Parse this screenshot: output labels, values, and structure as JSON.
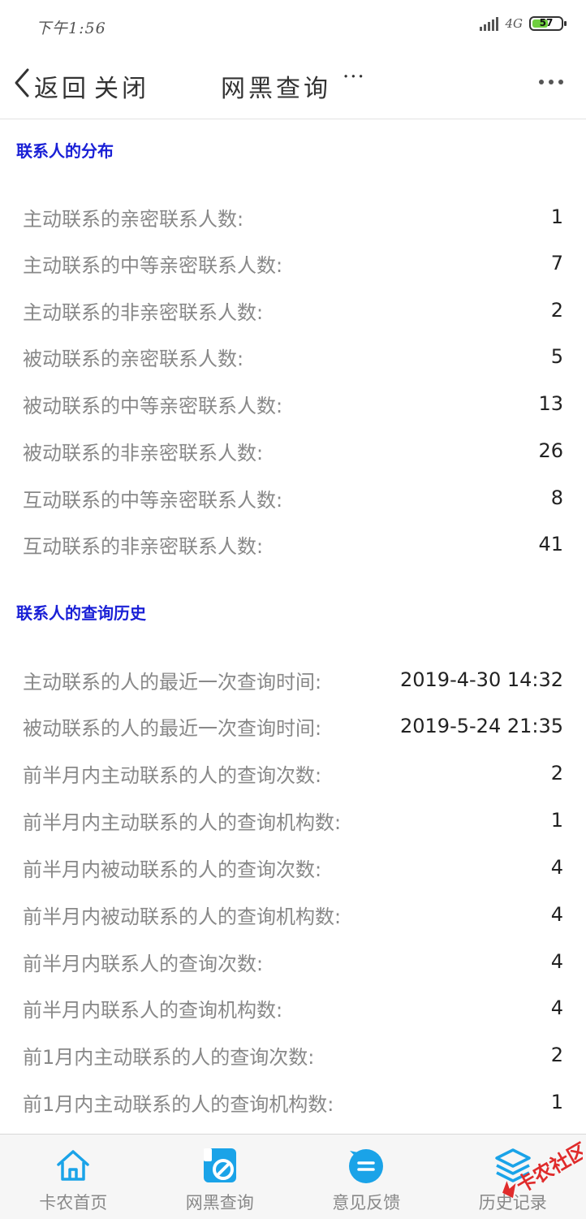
{
  "status_bar": {
    "time": "下午1:56",
    "network": "4G",
    "battery": "57"
  },
  "nav": {
    "back_label": "返回",
    "close_label": "关闭",
    "title": "网黑查询",
    "ellipsis": "···"
  },
  "sections": [
    {
      "title": "联系人的分布",
      "rows": [
        {
          "label": "主动联系的亲密联系人数:",
          "value": "1"
        },
        {
          "label": "主动联系的中等亲密联系人数:",
          "value": "7"
        },
        {
          "label": "主动联系的非亲密联系人数:",
          "value": "2"
        },
        {
          "label": "被动联系的亲密联系人数:",
          "value": "5"
        },
        {
          "label": "被动联系的中等亲密联系人数:",
          "value": "13"
        },
        {
          "label": "被动联系的非亲密联系人数:",
          "value": "26"
        },
        {
          "label": "互动联系的中等亲密联系人数:",
          "value": "8"
        },
        {
          "label": "互动联系的非亲密联系人数:",
          "value": "41"
        }
      ]
    },
    {
      "title": "联系人的查询历史",
      "rows": [
        {
          "label": "主动联系的人的最近一次查询时间:",
          "value": "2019-4-30 14:32"
        },
        {
          "label": "被动联系的人的最近一次查询时间:",
          "value": "2019-5-24 21:35"
        },
        {
          "label": "前半月内主动联系的人的查询次数:",
          "value": "2"
        },
        {
          "label": "前半月内主动联系的人的查询机构数:",
          "value": "1"
        },
        {
          "label": "前半月内被动联系的人的查询次数:",
          "value": "4"
        },
        {
          "label": "前半月内被动联系的人的查询机构数:",
          "value": "4"
        },
        {
          "label": "前半月内联系人的查询次数:",
          "value": "4"
        },
        {
          "label": "前半月内联系人的查询机构数:",
          "value": "4"
        },
        {
          "label": "前1月内主动联系的人的查询次数:",
          "value": "2"
        },
        {
          "label": "前1月内主动联系的人的查询机构数:",
          "value": "1"
        }
      ]
    }
  ],
  "tabs": [
    {
      "label": "卡农首页",
      "icon": "home-icon"
    },
    {
      "label": "网黑查询",
      "icon": "blacklist-query-icon"
    },
    {
      "label": "意见反馈",
      "icon": "feedback-icon"
    },
    {
      "label": "历史记录",
      "icon": "history-layers-icon"
    }
  ],
  "colors": {
    "accent": "#1aa3e8",
    "section_title": "#1a20d6",
    "label": "#888888",
    "watermark": "#e02b2b"
  },
  "watermark": {
    "text": "卡农社区"
  }
}
